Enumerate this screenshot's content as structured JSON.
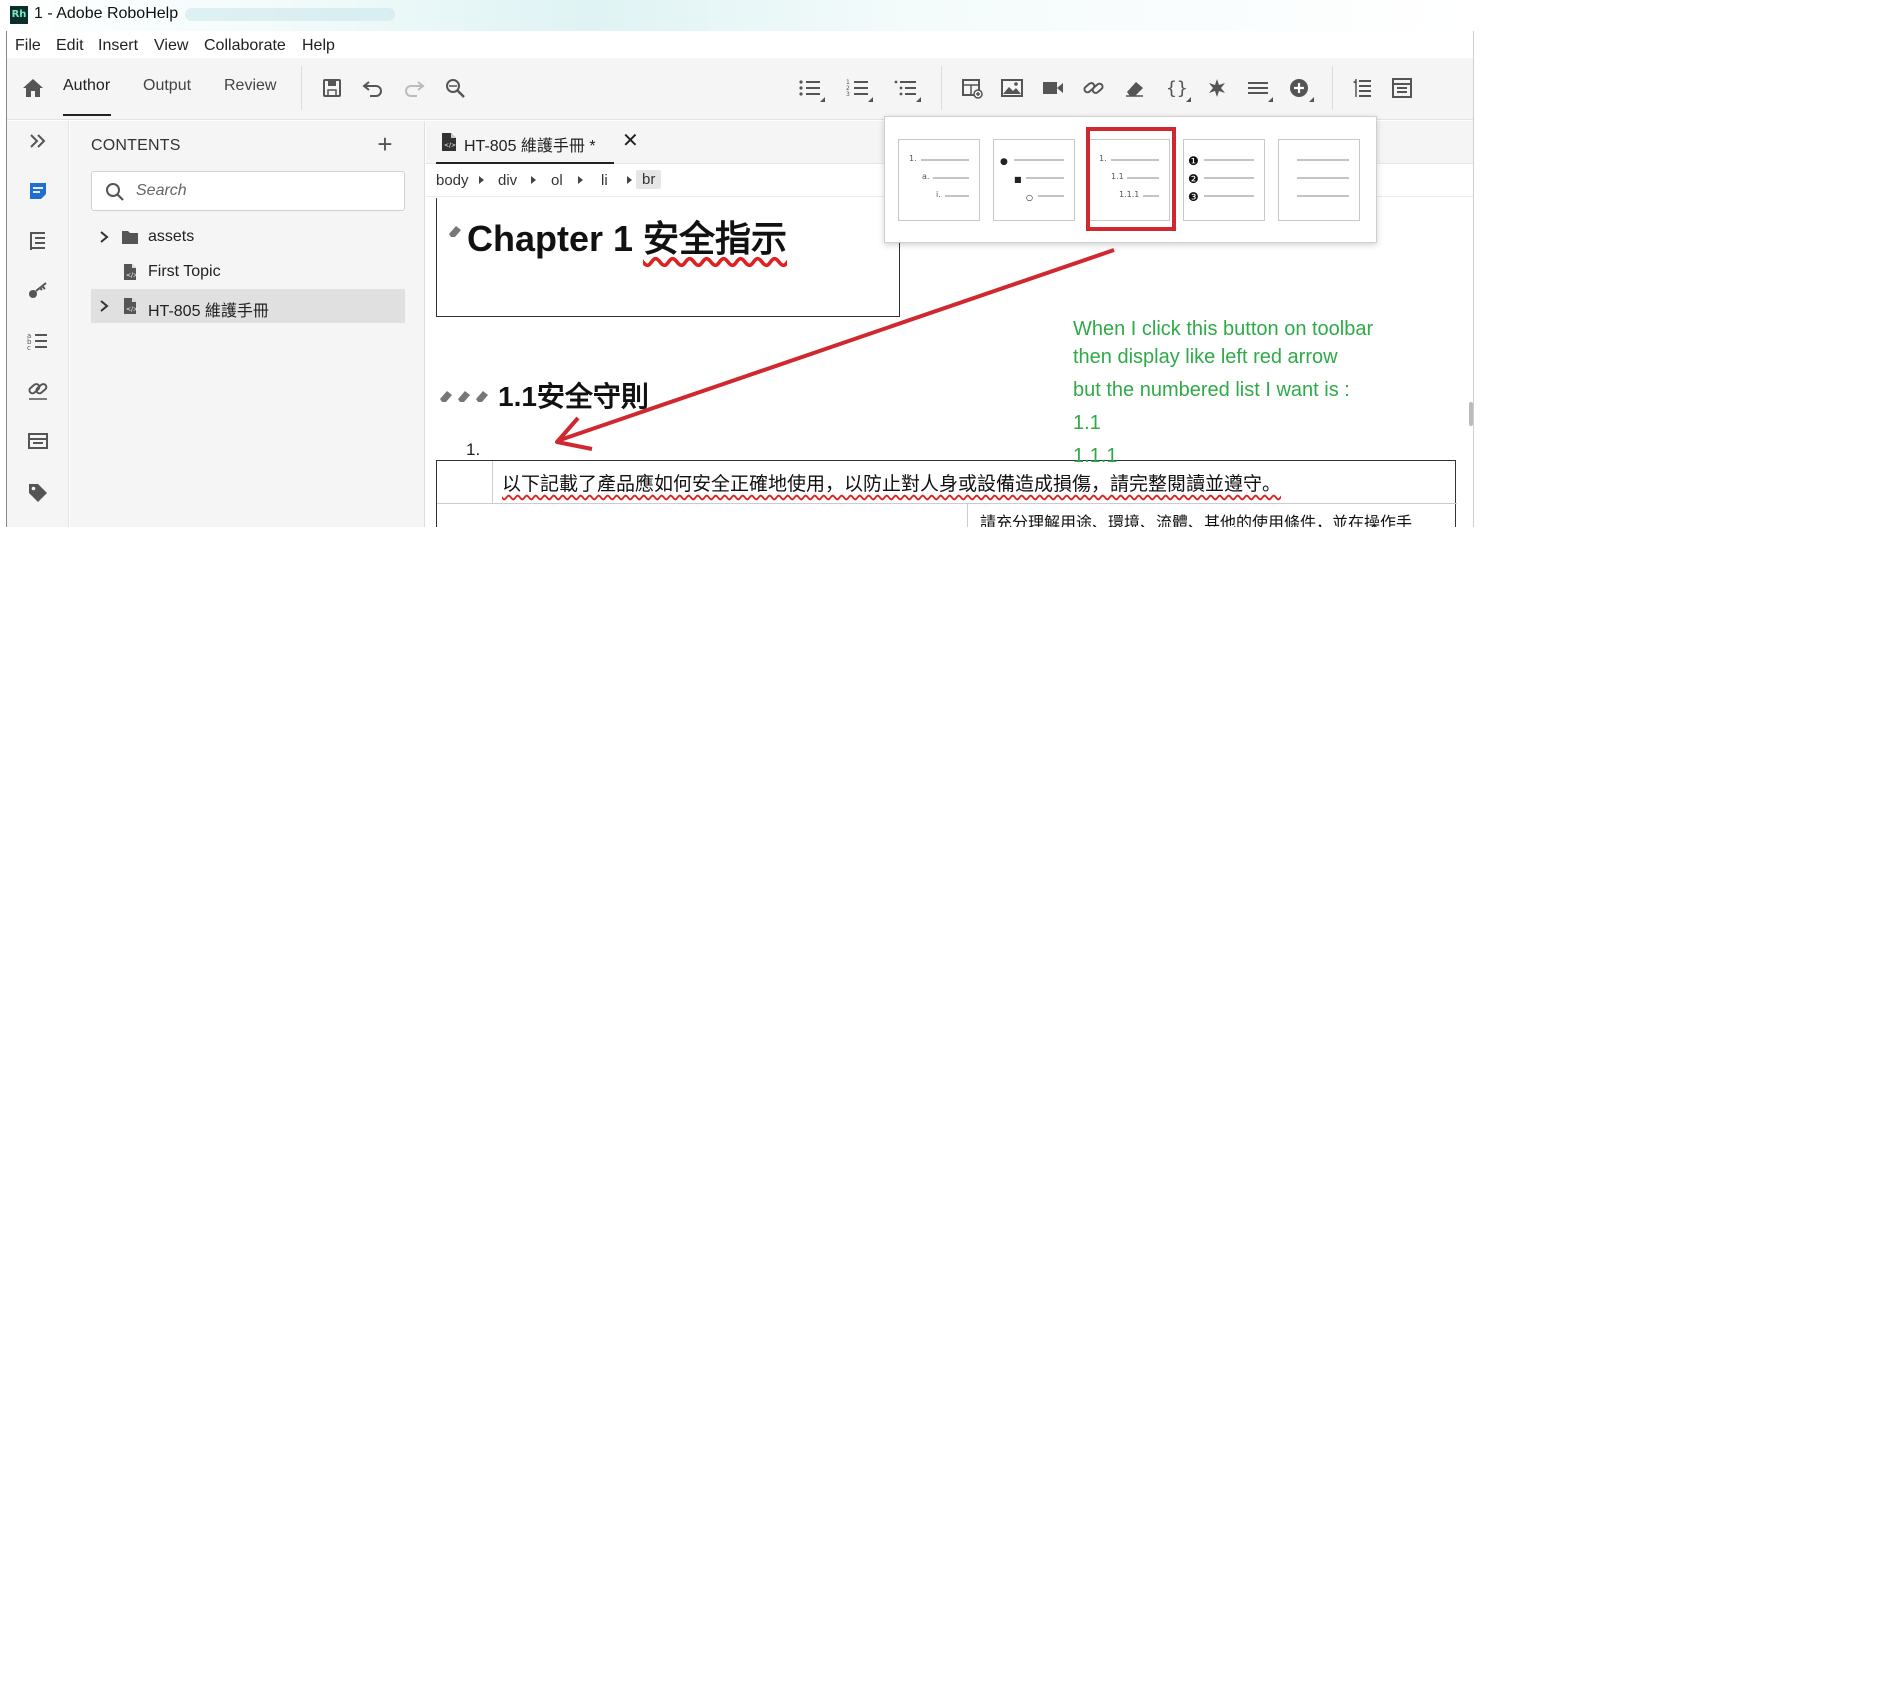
{
  "window": {
    "title": "1 - Adobe RoboHelp",
    "app_icon": "Rh"
  },
  "menu": [
    "File",
    "Edit",
    "Insert",
    "View",
    "Collaborate",
    "Help"
  ],
  "toolbar": {
    "tabs": [
      {
        "label": "Author",
        "active": true
      },
      {
        "label": "Output",
        "active": false
      },
      {
        "label": "Review",
        "active": false
      }
    ],
    "actions": [
      "home-icon",
      "save-icon",
      "undo-icon",
      "redo-icon",
      "find-replace-icon"
    ],
    "list_buttons": [
      "bulleted-list-icon",
      "numbered-list-icon",
      "multilevel-list-icon"
    ],
    "insert_buttons": [
      "insert-table-icon",
      "insert-image-icon",
      "insert-video-icon",
      "insert-link-icon",
      "eraser-icon",
      "variable-braces-icon",
      "symbol-star-icon",
      "horizontal-rule-icon",
      "add-circle-icon"
    ],
    "panel_buttons": [
      "properties-panel-icon",
      "preview-panel-icon"
    ]
  },
  "rail": [
    "expand-icon",
    "contents-icon",
    "toc-icon",
    "index-key-icon",
    "glossary-icon",
    "links-icon",
    "snippets-icon",
    "tags-icon"
  ],
  "contents": {
    "title": "CONTENTS",
    "add_label": "+",
    "search_placeholder": "Search",
    "items": [
      {
        "label": "assets",
        "type": "folder",
        "expandable": true,
        "selected": false
      },
      {
        "label": "First Topic",
        "type": "topic",
        "expandable": false,
        "selected": false
      },
      {
        "label": "HT-805 維護手冊",
        "type": "topic",
        "expandable": true,
        "selected": true
      }
    ]
  },
  "editor": {
    "tab_label": "HT-805 維護手冊 *",
    "tab_close": "✕",
    "breadcrumb": [
      "body",
      "div",
      "ol",
      "li",
      "br"
    ],
    "heading1_prefix": "Chapter 1 ",
    "heading1_cjk": "安全指示",
    "heading2": "1.1安全守則",
    "list_number": "1.",
    "table_row1": "以下記載了產品應如何安全正確地使用，以防止對人身或設備造成損傷，請完整閱讀並遵守。",
    "table_row2": "請充分理解用途、環境、流體、其他的使用條件，並在操作手"
  },
  "list_styles": {
    "selected_index": 2,
    "options": [
      {
        "name": "numeric-alpha-roman",
        "markers": [
          "1.",
          "a.",
          "i."
        ]
      },
      {
        "name": "bullet-square-circle",
        "markers": [
          "●",
          "■",
          "○"
        ]
      },
      {
        "name": "legal-multilevel",
        "markers": [
          "1.",
          "1.1",
          "1.1.1"
        ]
      },
      {
        "name": "circled-numbers",
        "markers": [
          "❶",
          "❷",
          "❸"
        ]
      },
      {
        "name": "none",
        "markers": []
      }
    ]
  },
  "annotation": {
    "color": "#2eab48",
    "arrow_color": "#d0282e",
    "lines": [
      "When I click this button on toolbar",
      "then display like left red arrow",
      "but the numbered list I want is :",
      "1.1",
      "1.1.1"
    ]
  }
}
